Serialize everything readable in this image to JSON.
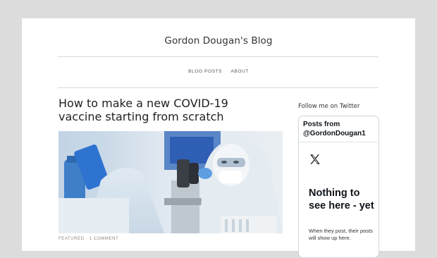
{
  "site": {
    "title": "Gordon Dougan's Blog"
  },
  "nav": {
    "items": [
      {
        "label": "BLOG POSTS"
      },
      {
        "label": "ABOUT"
      }
    ]
  },
  "post": {
    "title": "How to make a new COVID-19 vaccine starting from scratch",
    "category": "FEATURED",
    "separator": "·",
    "comments": "1 COMMENT"
  },
  "sidebar": {
    "heading": "Follow me on Twitter",
    "twitter": {
      "header": "Posts from @GordonDougan1",
      "empty_title": "Nothing to see here - yet",
      "empty_text": "When they post, their posts will show up here."
    }
  }
}
